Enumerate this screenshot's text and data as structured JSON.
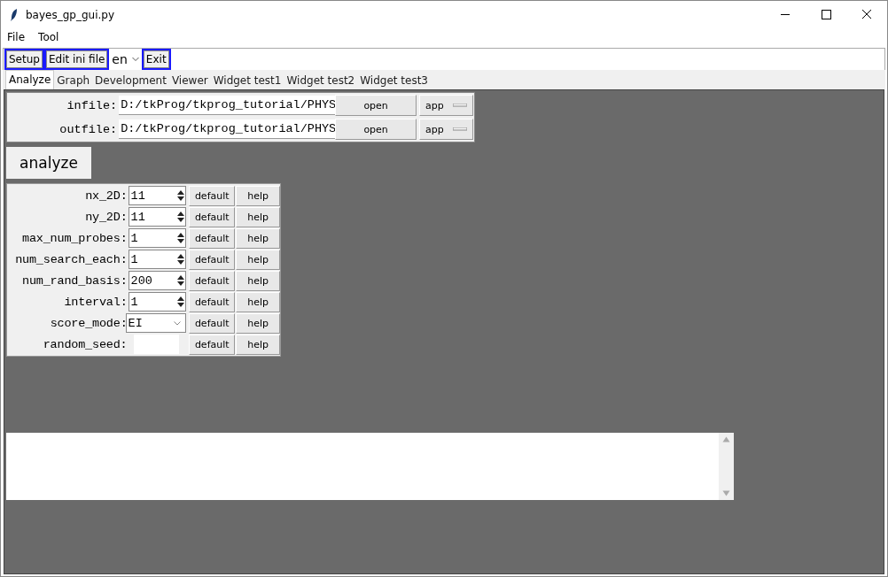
{
  "window": {
    "title": "bayes_gp_gui.py"
  },
  "menu": [
    "File",
    "Tool"
  ],
  "toolbar": [
    {
      "kind": "button",
      "label": "Setup"
    },
    {
      "kind": "button",
      "label": "Edit ini file"
    },
    {
      "kind": "combo",
      "label": "en"
    },
    {
      "kind": "button",
      "label": "Exit"
    }
  ],
  "tabs": [
    {
      "label": "Analyze",
      "selected": true
    },
    {
      "label": "Graph",
      "selected": false
    },
    {
      "label": "Development",
      "selected": false
    },
    {
      "label": "Viewer",
      "selected": false
    },
    {
      "label": "Widget test1",
      "selected": false
    },
    {
      "label": "Widget test2",
      "selected": false
    },
    {
      "label": "Widget test3",
      "selected": false
    }
  ],
  "files": [
    {
      "label": "infile:",
      "path": "D:/tkProg/tkprog_tutorial/PHYS",
      "button": "open",
      "menu": "app"
    },
    {
      "label": "outfile:",
      "path": "D:/tkProg/tkprog_tutorial/PHYS",
      "button": "open",
      "menu": "app"
    }
  ],
  "analyze_button": "analyze",
  "params": [
    {
      "label": "nx_2D:",
      "kind": "spinbox",
      "value": "11",
      "default": "default",
      "help": "help"
    },
    {
      "label": "ny_2D:",
      "kind": "spinbox",
      "value": "11",
      "default": "default",
      "help": "help"
    },
    {
      "label": "max_num_probes:",
      "kind": "spinbox",
      "value": "1",
      "default": "default",
      "help": "help"
    },
    {
      "label": "num_search_each:",
      "kind": "spinbox",
      "value": "1",
      "default": "default",
      "help": "help"
    },
    {
      "label": "num_rand_basis:",
      "kind": "spinbox",
      "value": "200",
      "default": "default",
      "help": "help"
    },
    {
      "label": "interval:",
      "kind": "spinbox",
      "value": "1",
      "default": "default",
      "help": "help"
    },
    {
      "label": "score_mode:",
      "kind": "combo",
      "value": "EI",
      "default": "default",
      "help": "help"
    },
    {
      "label": "random_seed:",
      "kind": "entry",
      "default": "default",
      "help": "help"
    }
  ]
}
